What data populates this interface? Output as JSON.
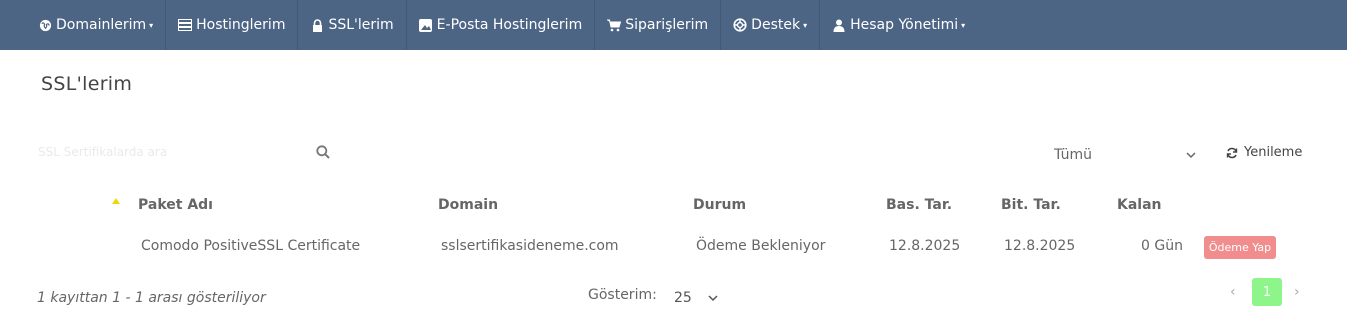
{
  "nav": {
    "items": [
      {
        "label": "Domainlerim",
        "icon": "globe-icon",
        "caret": "▾"
      },
      {
        "label": "Hostinglerim",
        "icon": "server-icon"
      },
      {
        "label": "SSL'lerim",
        "icon": "lock-icon"
      },
      {
        "label": "E-Posta Hostinglerim",
        "icon": "image-icon"
      },
      {
        "label": "Siparişlerim",
        "icon": "cart-icon"
      },
      {
        "label": "Destek",
        "icon": "lifebuoy-icon",
        "caret": "▾"
      },
      {
        "label": "Hesap Yönetimi",
        "icon": "user-icon",
        "caret": "▾"
      }
    ]
  },
  "page": {
    "title": "SSL'lerim"
  },
  "toolbar": {
    "search_placeholder": "SSL Sertifikalarda ara",
    "filter_value": "Tümü",
    "refresh_label": "Yenileme"
  },
  "table": {
    "columns": [
      "Paket Adı",
      "Domain",
      "Durum",
      "Bas. Tar.",
      "Bit. Tar.",
      "Kalan"
    ],
    "rows": [
      {
        "package": "Comodo PositiveSSL Certificate",
        "domain": "sslsertifikasideneme.com",
        "status": "Ödeme Bekleniyor",
        "start": "12.8.2025",
        "end": "12.8.2025",
        "remaining": "0 Gün",
        "action": "Ödeme Yap"
      }
    ]
  },
  "footer": {
    "info": "1 kayıttan 1 - 1 arası gösteriliyor",
    "show_label": "Gösterim:",
    "show_value": "25",
    "prev": "‹",
    "page": "1",
    "next": "›"
  },
  "colors": {
    "navbar": "#4d6585",
    "pay_button": "#f18d8d",
    "active_page": "#8ef58a",
    "sort_arrow": "#f2d600"
  }
}
